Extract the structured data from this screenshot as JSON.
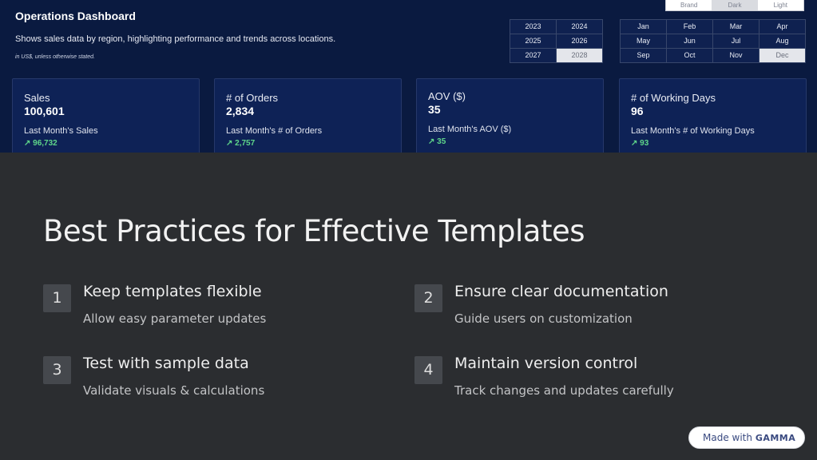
{
  "dashboard": {
    "title": "Operations Dashboard",
    "description": "Shows sales data by region, highlighting performance and trends across locations.",
    "note": "in US$, unless otherwise stated.",
    "theme_options": [
      {
        "label": "Brand",
        "active": false
      },
      {
        "label": "Dark",
        "active": true
      },
      {
        "label": "Light",
        "active": false
      }
    ],
    "years": [
      {
        "label": "2023",
        "selected": false
      },
      {
        "label": "2024",
        "selected": false
      },
      {
        "label": "2025",
        "selected": false
      },
      {
        "label": "2026",
        "selected": false
      },
      {
        "label": "2027",
        "selected": false
      },
      {
        "label": "2028",
        "selected": true
      }
    ],
    "months": [
      {
        "label": "Jan",
        "selected": false
      },
      {
        "label": "Feb",
        "selected": false
      },
      {
        "label": "Mar",
        "selected": false
      },
      {
        "label": "Apr",
        "selected": false
      },
      {
        "label": "May",
        "selected": false
      },
      {
        "label": "Jun",
        "selected": false
      },
      {
        "label": "Jul",
        "selected": false
      },
      {
        "label": "Aug",
        "selected": false
      },
      {
        "label": "Sep",
        "selected": false
      },
      {
        "label": "Oct",
        "selected": false
      },
      {
        "label": "Nov",
        "selected": false
      },
      {
        "label": "Dec",
        "selected": true
      }
    ],
    "kpis": [
      {
        "label": "Sales",
        "value": "100,601",
        "sub_label": "Last Month's Sales",
        "trend": "↗ 96,732"
      },
      {
        "label": "# of Orders",
        "value": "2,834",
        "sub_label": "Last Month's # of Orders",
        "trend": "↗ 2,757"
      },
      {
        "label": "AOV ($)",
        "value": "35",
        "sub_label": "Last Month's AOV ($)",
        "trend": "↗ 35"
      },
      {
        "label": "# of Working Days",
        "value": "96",
        "sub_label": "Last Month's # of Working Days",
        "trend": "↗ 93"
      }
    ]
  },
  "slide": {
    "heading": "Best Practices for Effective Templates",
    "items": [
      {
        "number": "1",
        "title": "Keep templates flexible",
        "description": "Allow easy parameter updates"
      },
      {
        "number": "2",
        "title": "Ensure clear documentation",
        "description": "Guide users on customization"
      },
      {
        "number": "3",
        "title": "Test with sample data",
        "description": "Validate visuals & calculations"
      },
      {
        "number": "4",
        "title": "Maintain version control",
        "description": "Track changes and updates carefully"
      }
    ]
  },
  "badge": {
    "prefix": "Made with",
    "brand": "GAMMA"
  },
  "colors": {
    "dashboard_bg": "#0a1a40",
    "slide_bg": "#2b2d30",
    "trend_green": "#5fd68a"
  }
}
